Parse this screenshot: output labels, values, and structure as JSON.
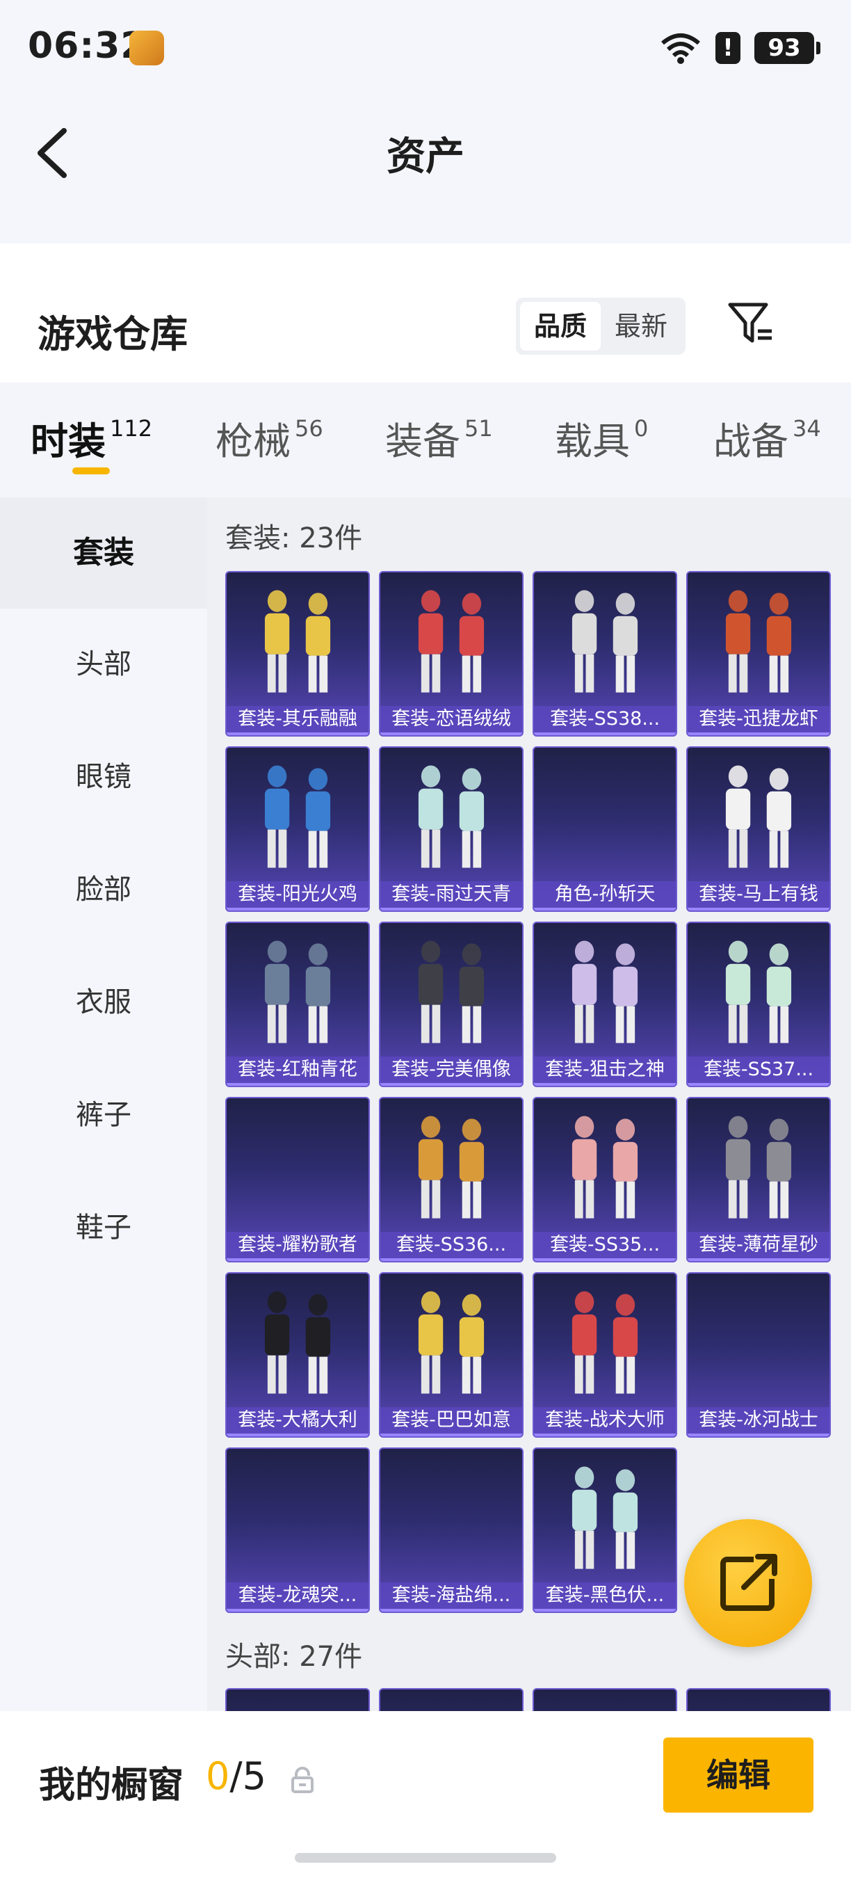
{
  "status_bar": {
    "time": "06:32",
    "battery": "93"
  },
  "header": {
    "title": "资产"
  },
  "section": {
    "title": "游戏仓库",
    "sort_options": [
      "品质",
      "最新"
    ],
    "sort_selected": "品质"
  },
  "tabs": [
    {
      "label": "时装",
      "count": "112"
    },
    {
      "label": "枪械",
      "count": "56"
    },
    {
      "label": "装备",
      "count": "51"
    },
    {
      "label": "载具",
      "count": "0"
    },
    {
      "label": "战备",
      "count": "34"
    }
  ],
  "sidebar": {
    "items": [
      "套装",
      "头部",
      "眼镜",
      "脸部",
      "衣服",
      "裤子",
      "鞋子"
    ]
  },
  "groups": [
    {
      "title": "套装: 23件",
      "items": [
        "套装-其乐融融",
        "套装-恋语绒绒",
        "套装-SS38...",
        "套装-迅捷龙虾",
        "套装-阳光火鸡",
        "套装-雨过天青",
        "角色-孙斩天",
        "套装-马上有钱",
        "套装-红釉青花",
        "套装-完美偶像",
        "套装-狙击之神",
        "套装-SS37...",
        "套装-耀粉歌者",
        "套装-SS36...",
        "套装-SS35...",
        "套装-薄荷星砂",
        "套装-大橘大利",
        "套装-巴巴如意",
        "套装-战术大师",
        "套装-冰河战士",
        "套装-龙魂突...",
        "套装-海盐绵...",
        "套装-黑色伏..."
      ]
    },
    {
      "title": "头部: 27件"
    }
  ],
  "bottom_bar": {
    "label": "我的橱窗",
    "current": "0",
    "separator": "/",
    "max": "5",
    "edit_label": "编辑"
  },
  "colors": {
    "accent": "#f7b500",
    "tile_purple": "#5847b7"
  }
}
